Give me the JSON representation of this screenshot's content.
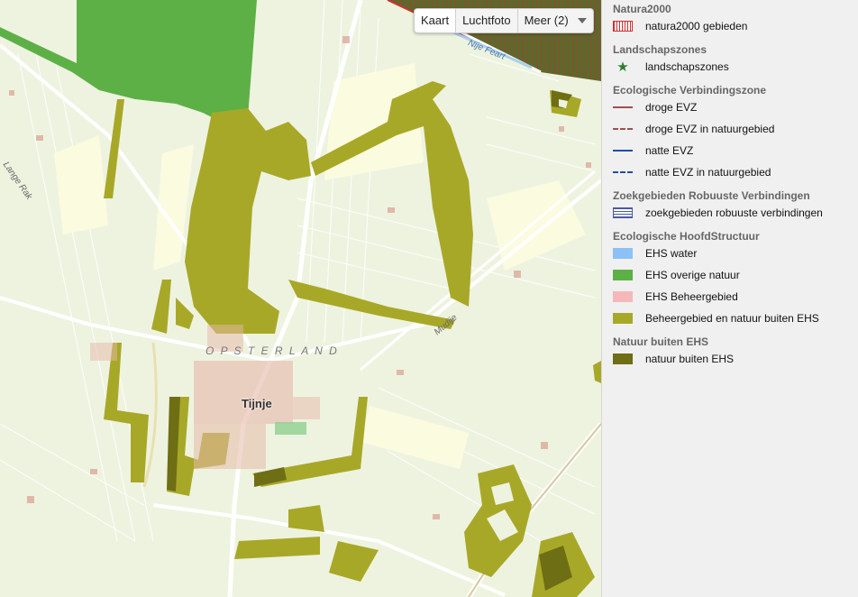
{
  "map": {
    "labels": {
      "town": "Tijnje",
      "region": "O P S T E R L A N D",
      "road_north": "Nije Feart",
      "road_east": "Mudije",
      "road_west": "Lange Rak"
    },
    "colors": {
      "background": "#eef3e0",
      "ehs_overige_natuur": "#5db046",
      "ehs_water": "#8cc1f5",
      "beheergebied": "#a8a828",
      "natuur_buiten_ehs": "#6e6e14",
      "natura2000_hatch": "#b03a3a",
      "roads": "#ffffff",
      "buildings": "#e6b8a8"
    }
  },
  "map_switch": {
    "buttons": [
      "Kaart",
      "Luchtfoto",
      "Meer (2)"
    ]
  },
  "legend": {
    "sections": [
      {
        "title": "Natura2000",
        "items": [
          {
            "label": "natura2000 gebieden",
            "symbol": "hatch-box",
            "color": "#d03030"
          }
        ]
      },
      {
        "title": "Landschapszones",
        "items": [
          {
            "label": "landschapszones",
            "symbol": "star-icon",
            "color": "#2d7d2d"
          }
        ]
      },
      {
        "title": "Ecologische Verbindingszone",
        "items": [
          {
            "label": "droge EVZ",
            "symbol": "line",
            "color": "#a05050"
          },
          {
            "label": "droge EVZ in natuurgebied",
            "symbol": "dash",
            "color": "#a05050"
          },
          {
            "label": "natte EVZ",
            "symbol": "line",
            "color": "#1f4fa0"
          },
          {
            "label": "natte EVZ in natuurgebied",
            "symbol": "dash",
            "color": "#1f4fa0"
          }
        ]
      },
      {
        "title": "Zoekgebieden Robuuste Verbindingen",
        "items": [
          {
            "label": "zoekgebieden robuuste verbindingen",
            "symbol": "stripe-box",
            "color": "#4a5aa0"
          }
        ]
      },
      {
        "title": "Ecologische HoofdStructuur",
        "items": [
          {
            "label": "EHS water",
            "symbol": "fill",
            "color": "#8cc1f5"
          },
          {
            "label": "EHS overige natuur",
            "symbol": "fill",
            "color": "#5db046"
          },
          {
            "label": "EHS Beheergebied",
            "symbol": "fill",
            "color": "#f5b8b8"
          },
          {
            "label": "Beheergebied en natuur buiten EHS",
            "symbol": "fill",
            "color": "#a8a828"
          }
        ]
      },
      {
        "title": "Natuur buiten EHS",
        "items": [
          {
            "label": "natuur buiten EHS",
            "symbol": "fill",
            "color": "#6e6e14"
          }
        ]
      }
    ]
  }
}
